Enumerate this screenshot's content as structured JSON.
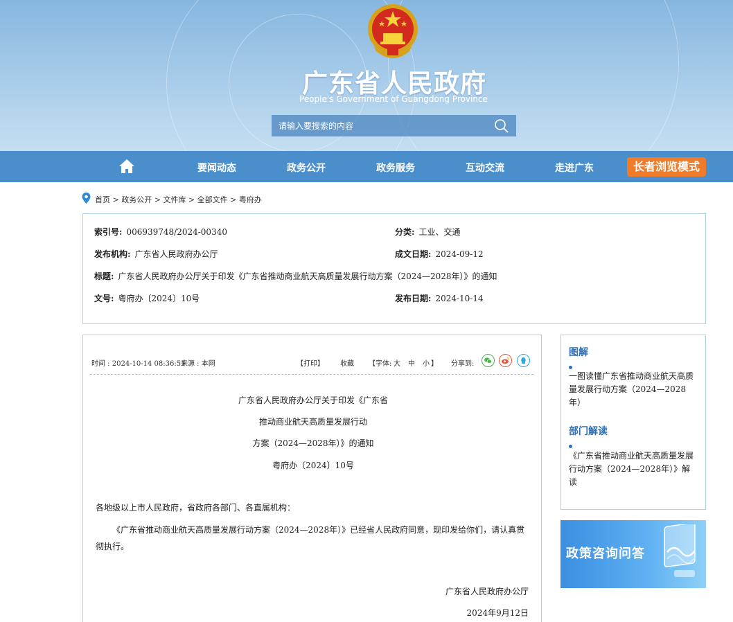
{
  "header": {
    "title": "广东省人民政府",
    "subtitle": "People's Government of Guangdong Province",
    "search_placeholder": "请输入要搜索的内容"
  },
  "nav": {
    "items": [
      "要闻动态",
      "政务公开",
      "政务服务",
      "互动交流",
      "走进广东"
    ],
    "elder_mode": "长者浏览模式"
  },
  "breadcrumb": [
    "首页",
    "政务公开",
    "文件库",
    "全部文件",
    "粤府办"
  ],
  "meta": {
    "index_no_label": "索引号:",
    "index_no": "006939748/2024-00340",
    "category_label": "分类:",
    "category": "工业、交通",
    "publisher_label": "发布机构:",
    "publisher": "广东省人民政府办公厅",
    "created_label": "成文日期:",
    "created": "2024-09-12",
    "title_label": "标题:",
    "title": "广东省人民政府办公厅关于印发《广东省推动商业航天高质量发展行动方案（2024—2028年）》的通知",
    "doc_no_label": "文号:",
    "doc_no": "粤府办〔2024〕10号",
    "published_label": "发布日期:",
    "published": "2024-10-14"
  },
  "toolbar": {
    "time": "时间 : 2024-10-14 08:36:51",
    "source": "来源 : 本网",
    "print": "【打印】",
    "collect": "收藏",
    "font_open": "【字体:",
    "font_large": "大",
    "font_medium": "中",
    "font_small": "小",
    "font_close": "】",
    "share": "分享到:"
  },
  "article": {
    "title_lines": [
      "广东省人民政府办公厅关于印发《广东省",
      "推动商业航天高质量发展行动",
      "方案（2024—2028年）》的通知"
    ],
    "doc_no": "粤府办〔2024〕10号",
    "salutation": "各地级以上市人民政府，省政府各部门、各直属机构：",
    "paragraph": "《广东省推动商业航天高质量发展行动方案（2024—2028年）》已经省人民政府同意，现印发给你们，请认真贯彻执行。",
    "signer": "广东省人民政府办公厅",
    "date": "2024年9月12日"
  },
  "sidebar": {
    "section1_title": "图解",
    "section1_link": "一图读懂广东省推动商业航天高质量发展行动方案（2024—2028年）",
    "section2_title": "部门解读",
    "section2_link": "《广东省推动商业航天高质量发展行动方案（2024—2028年）》解读"
  },
  "promo": {
    "text": "政策咨询问答"
  },
  "colors": {
    "nav_bg": "#4a8fcb",
    "accent": "#2d6fb6",
    "elder_btn": "#f07c2a",
    "border": "#a9d1ea"
  }
}
